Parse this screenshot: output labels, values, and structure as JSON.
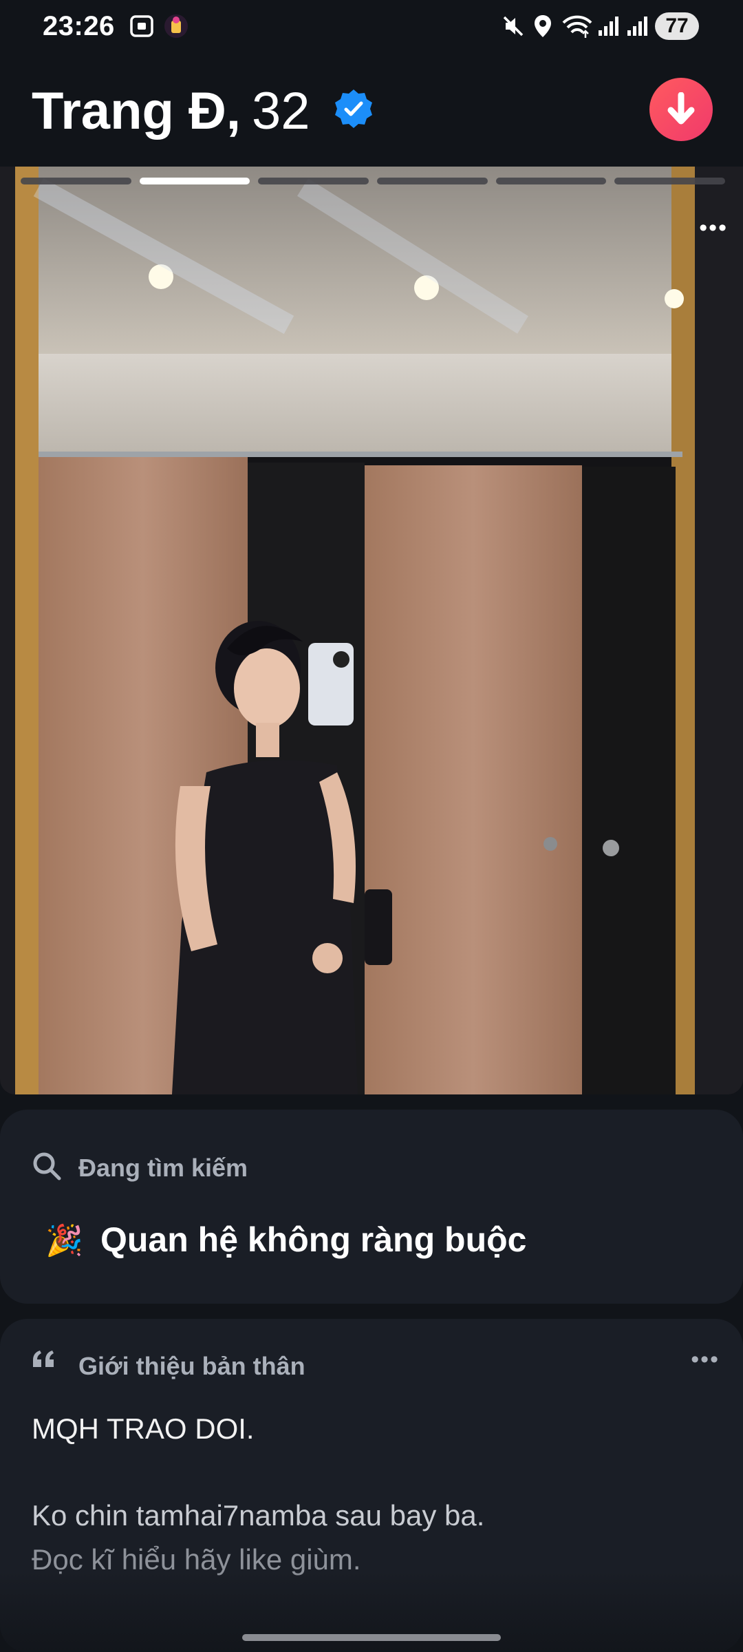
{
  "status_bar": {
    "time": "23:26",
    "battery": "77",
    "icons": [
      "screenshot-icon",
      "app-notification-icon",
      "mute-icon",
      "location-icon",
      "wifi-icon",
      "signal-icon",
      "signal-icon"
    ]
  },
  "profile": {
    "name": "Trang Đ,",
    "age": "32",
    "verified_icon": "verified-badge-icon",
    "action_icon": "arrow-down-icon",
    "accent_color": "#ff4458"
  },
  "photo": {
    "total_photos": 6,
    "active_index": 1,
    "more_label": "•••"
  },
  "looking_for": {
    "label": "Đang tìm kiếm",
    "icon": "search-icon",
    "emoji": "🎉",
    "value": "Quan hệ không ràng buộc"
  },
  "bio": {
    "label": "Giới thiệu bản thân",
    "icon": "quote-icon",
    "more_label": "•••",
    "line1": "MQH TRAO DOI.",
    "line2": "Ko chin tamhai7namba sau bay ba.",
    "line3": "Đọc kĩ hiểu hãy like giùm."
  }
}
